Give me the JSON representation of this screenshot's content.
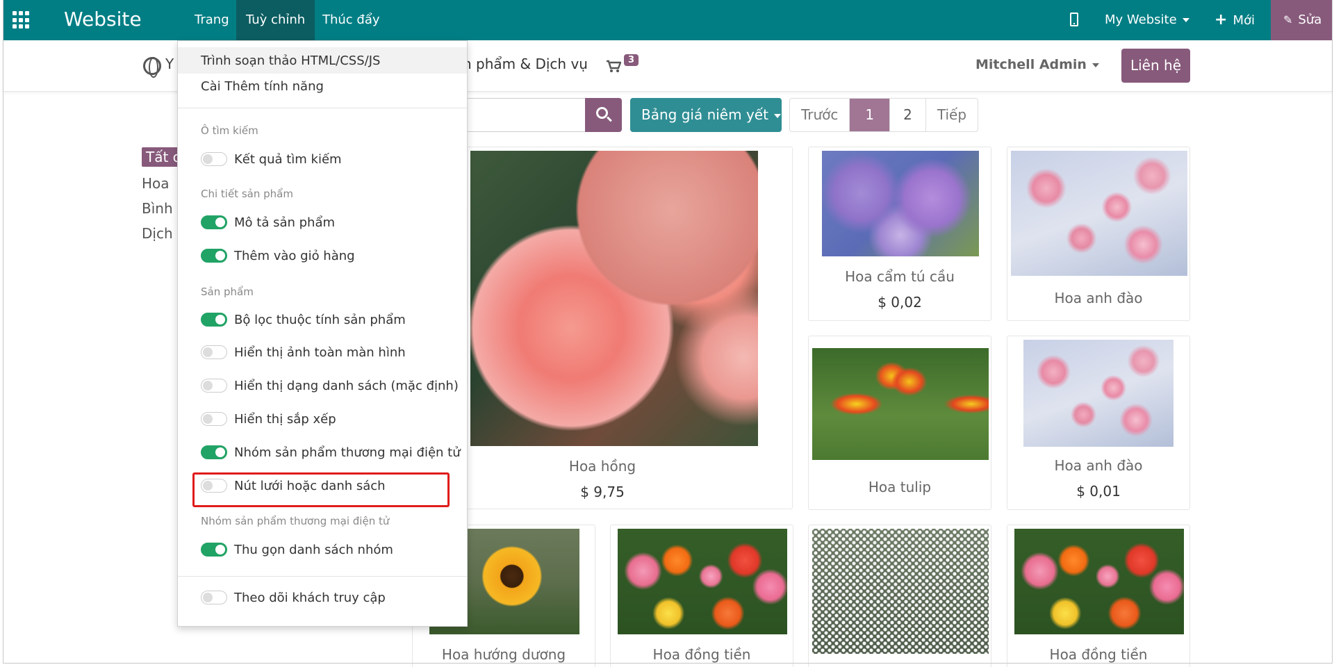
{
  "topbar": {
    "brand": "Website",
    "menus": [
      "Trang",
      "Tuỳ chỉnh",
      "Thúc đẩy"
    ],
    "my_website": "My Website",
    "new_label": "Mới",
    "edit_label": "Sửa",
    "color": "#017e84"
  },
  "site_header": {
    "nav_y": "Y",
    "nav_products": "n phẩm & Dịch vụ",
    "cart_count": "3",
    "user": "Mitchell Admin",
    "contact": "Liên hệ"
  },
  "toolbar": {
    "pricelist": "Bảng giá niêm yết",
    "pager": {
      "prev": "Trước",
      "pages": [
        "1",
        "2"
      ],
      "current": "1",
      "next": "Tiếp"
    }
  },
  "categories": [
    "Tất c",
    "Hoa",
    "Bình",
    "Dịch"
  ],
  "products": [
    {
      "name": "Hoa hồng",
      "price": "$ 9,75"
    },
    {
      "name": "Hoa cẩm tú cầu",
      "price": "$ 0,02"
    },
    {
      "name": "Hoa anh đào",
      "price": ""
    },
    {
      "name": "Hoa tulip",
      "price": ""
    },
    {
      "name": "Hoa anh đào",
      "price": "$ 0,01"
    },
    {
      "name": "Hoa hướng dương",
      "price": ""
    },
    {
      "name": "Hoa đồng tiền",
      "price": ""
    },
    {
      "name": "",
      "price": ""
    },
    {
      "name": "Hoa đồng tiền",
      "price": ""
    }
  ],
  "dropdown": {
    "items": [
      "Trình soạn thảo HTML/CSS/JS",
      "Cài Thêm tính năng"
    ],
    "sections": [
      {
        "heading": "Ô tìm kiếm",
        "options": [
          {
            "label": "Kết quả tìm kiếm",
            "on": false
          }
        ]
      },
      {
        "heading": "Chi tiết sản phẩm",
        "options": [
          {
            "label": "Mô tả sản phẩm",
            "on": true
          },
          {
            "label": "Thêm vào giỏ hàng",
            "on": true
          }
        ]
      },
      {
        "heading": "Sản phẩm",
        "options": [
          {
            "label": "Bộ lọc thuộc tính sản phẩm",
            "on": true
          },
          {
            "label": "Hiển thị ảnh toàn màn hình",
            "on": false
          },
          {
            "label": "Hiển thị dạng danh sách (mặc định)",
            "on": false
          },
          {
            "label": "Hiển thị sắp xếp",
            "on": false
          },
          {
            "label": "Nhóm sản phẩm thương mại điện tử",
            "on": true
          },
          {
            "label": "Nút lưới hoặc danh sách",
            "on": false
          }
        ]
      },
      {
        "heading": "Nhóm sản phẩm thương mại điện tử",
        "options": [
          {
            "label": "Thu gọn danh sách nhóm",
            "on": true
          }
        ]
      },
      {
        "heading": "",
        "options": [
          {
            "label": "Theo dõi khách truy cập",
            "on": false
          }
        ]
      }
    ]
  }
}
